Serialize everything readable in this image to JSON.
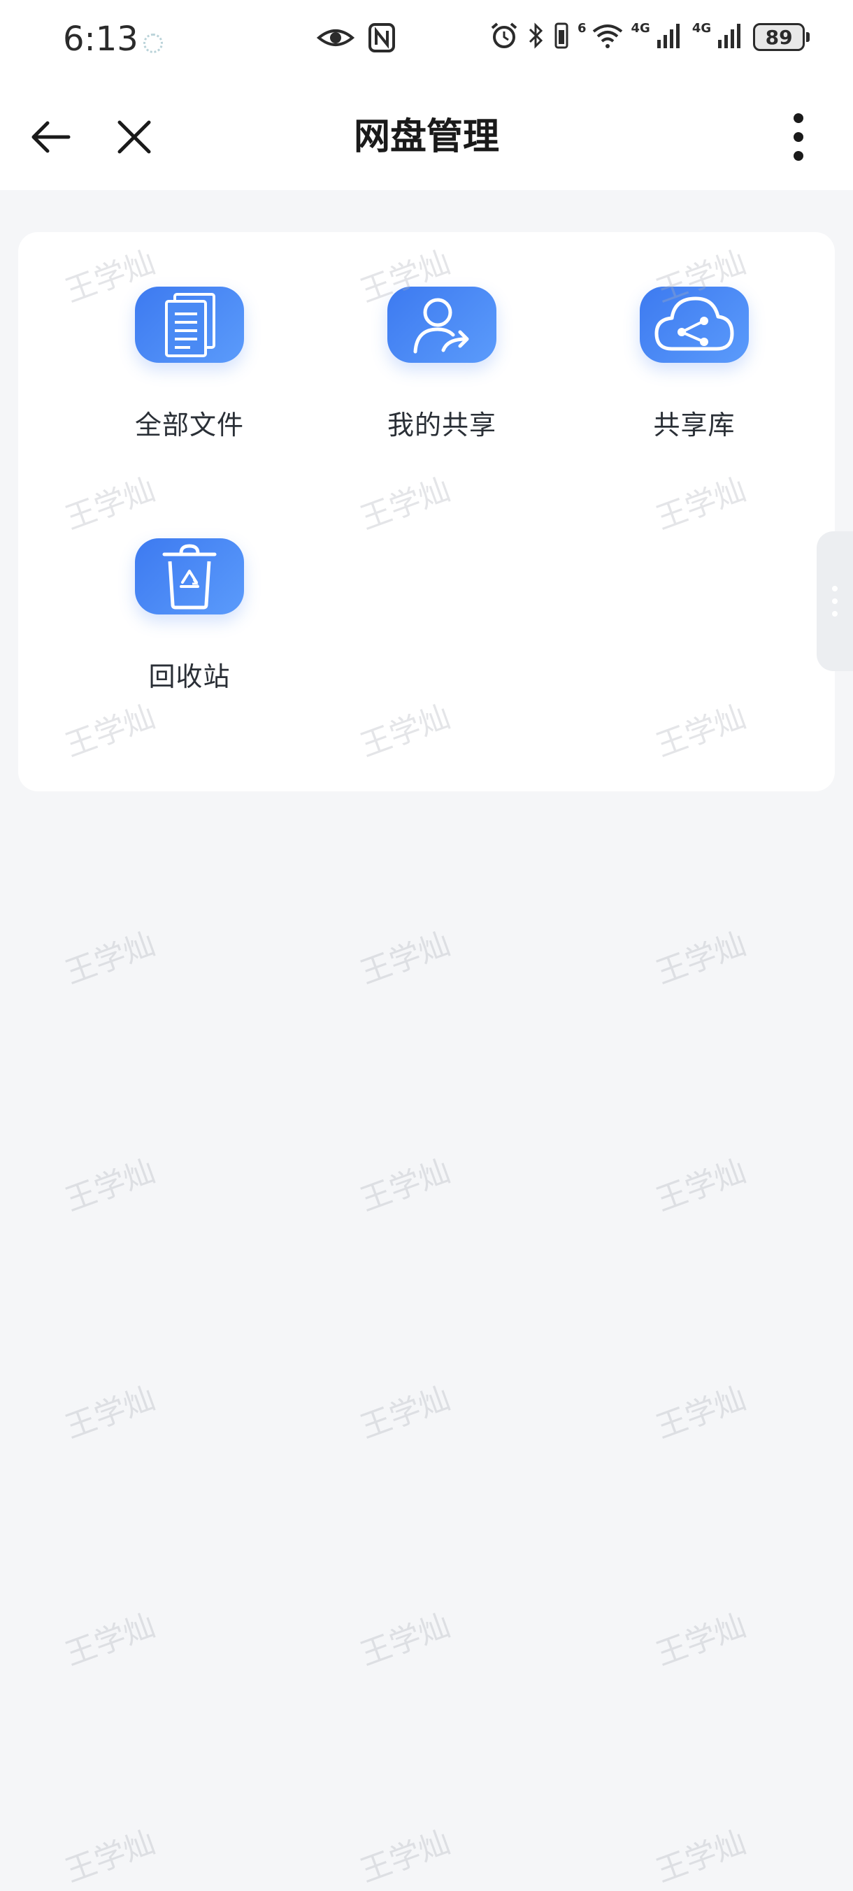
{
  "status_bar": {
    "time": "6:13",
    "signal_1_label": "4G",
    "signal_2_label": "4G",
    "wifi_label": "6",
    "battery": "89"
  },
  "nav": {
    "title": "网盘管理"
  },
  "tiles": [
    {
      "label": "全部文件",
      "icon": "documents-icon"
    },
    {
      "label": "我的共享",
      "icon": "user-share-icon"
    },
    {
      "label": "共享库",
      "icon": "cloud-share-icon"
    },
    {
      "label": "回收站",
      "icon": "recycle-bin-icon"
    }
  ],
  "watermark": "王学灿",
  "colors": {
    "accent": "#4a8af4",
    "background": "#f5f6f8",
    "card": "#ffffff"
  }
}
